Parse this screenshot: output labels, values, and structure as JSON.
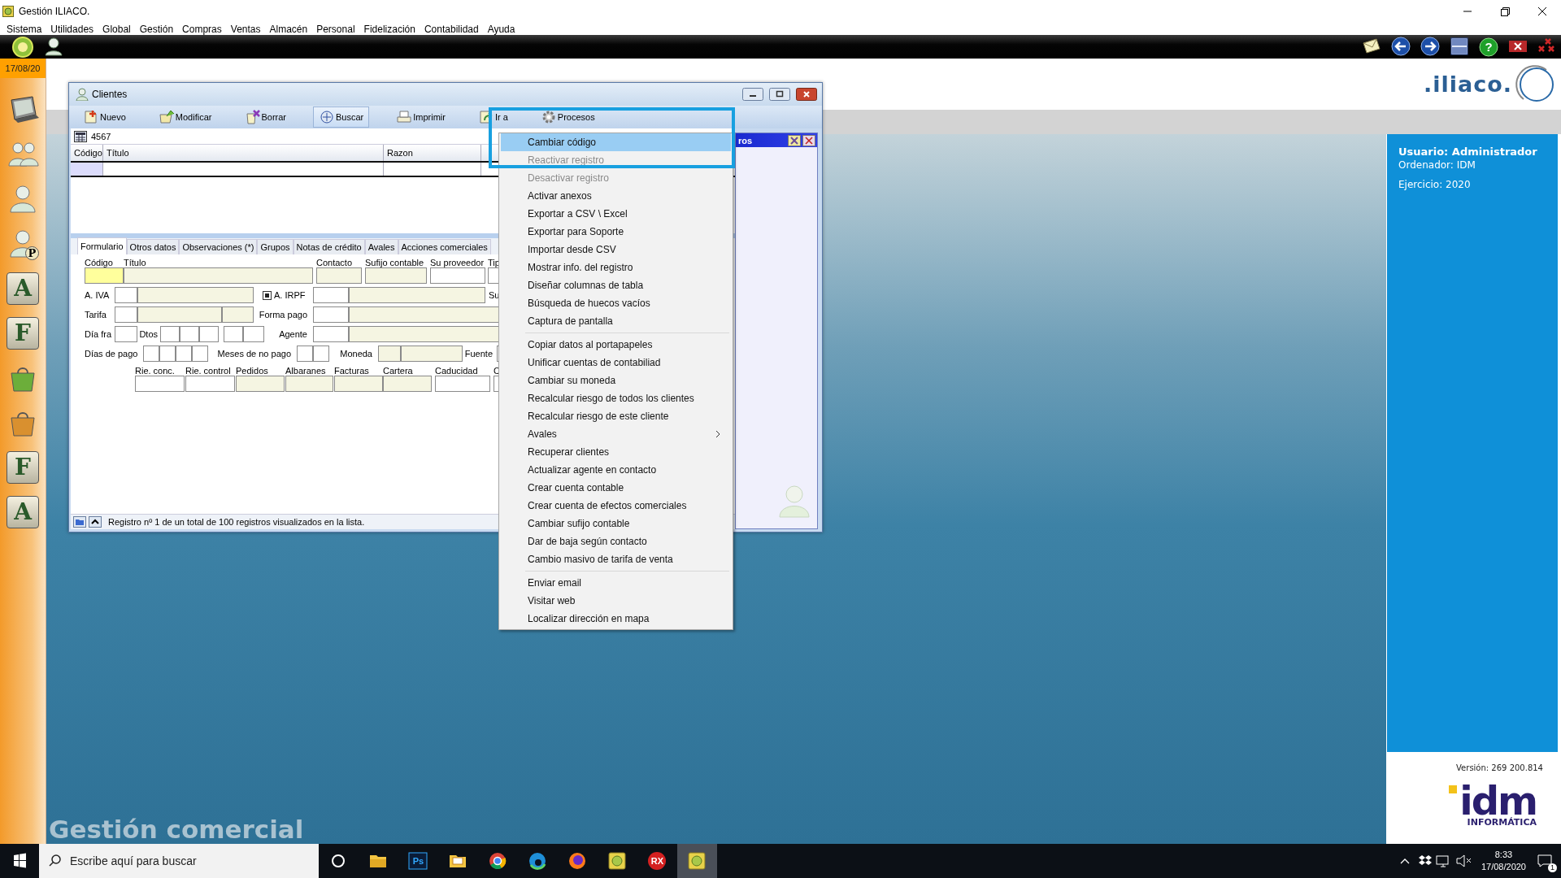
{
  "app": {
    "title": "Gestión ILIACO.",
    "menu": [
      "Sistema",
      "Utilidades",
      "Global",
      "Gestión",
      "Compras",
      "Ventas",
      "Almacén",
      "Personal",
      "Fidelización",
      "Contabilidad",
      "Ayuda"
    ]
  },
  "top_toolbar": {
    "left": [
      {
        "kind": "globe"
      },
      {
        "kind": "user"
      }
    ],
    "right": [
      {
        "kind": "mail"
      },
      {
        "kind": "back"
      },
      {
        "kind": "forward"
      },
      {
        "kind": "window"
      },
      {
        "kind": "help",
        "label": "?"
      },
      {
        "kind": "close"
      },
      {
        "kind": "close-all"
      }
    ]
  },
  "sidebar": {
    "date": "17/08/20",
    "items": [
      {
        "kind": "monitor"
      },
      {
        "kind": "people"
      },
      {
        "kind": "person"
      },
      {
        "kind": "person-letter",
        "label": "P"
      },
      {
        "kind": "letter",
        "label": "A"
      },
      {
        "kind": "letter",
        "label": "F"
      },
      {
        "kind": "bag",
        "color": "#6cae3a"
      },
      {
        "kind": "bag",
        "color": "#d9902f"
      },
      {
        "kind": "letter",
        "label": "F"
      },
      {
        "kind": "letter",
        "label": "A"
      }
    ]
  },
  "clients_window": {
    "title": "Clientes",
    "toolbar": [
      {
        "kind": "new",
        "label": "Nuevo",
        "selected": false
      },
      {
        "kind": "edit",
        "label": "Modificar",
        "selected": false
      },
      {
        "kind": "delete",
        "label": "Borrar",
        "selected": false
      },
      {
        "kind": "search",
        "label": "Buscar",
        "selected": true
      },
      {
        "kind": "print",
        "label": "Imprimir",
        "selected": false
      },
      {
        "kind": "goto",
        "label": "Ir a",
        "selected": false
      },
      {
        "kind": "process",
        "label": "Procesos",
        "selected": false
      }
    ],
    "record_code": "4567",
    "table": {
      "columns": [
        "Código",
        "Título",
        "Razon"
      ],
      "rows": [
        {
          "selected": true
        }
      ]
    },
    "tabs": [
      {
        "label": "Formulario",
        "selected": true
      },
      {
        "label": "Otros datos",
        "selected": false
      },
      {
        "label": "Observaciones (*)",
        "selected": false
      },
      {
        "label": "Grupos",
        "selected": false
      },
      {
        "label": "Notas de crédito",
        "selected": false
      },
      {
        "label": "Avales",
        "selected": false
      },
      {
        "label": "Acciones comerciales",
        "selected": false
      }
    ],
    "form": [
      {
        "kind": "stacked",
        "items": [
          {
            "label": "Código",
            "kind": "focused-field"
          },
          {
            "label": "Título",
            "kind": "readonly-field"
          },
          {
            "label": "Contacto",
            "kind": "readonly-field"
          },
          {
            "label": "Sufijo contable",
            "kind": "readonly-field"
          },
          {
            "label": "Su proveedor",
            "kind": "field"
          },
          {
            "label": "Tip",
            "kind": "field"
          }
        ]
      },
      {
        "kind": "inline",
        "items": [
          {
            "kind": "label",
            "text": "A. IVA"
          },
          {
            "kind": "field"
          },
          {
            "kind": "readonly-field"
          },
          {
            "kind": "checkbox",
            "text": "A. IRPF",
            "checked": true
          },
          {
            "kind": "field"
          },
          {
            "kind": "readonly-field"
          },
          {
            "kind": "label",
            "text": "Su"
          }
        ]
      },
      {
        "kind": "inline",
        "items": [
          {
            "kind": "label",
            "text": "Tarifa"
          },
          {
            "kind": "field"
          },
          {
            "kind": "readonly-field"
          },
          {
            "kind": "readonly-field"
          },
          {
            "kind": "label",
            "text": "Forma pago"
          },
          {
            "kind": "field"
          },
          {
            "kind": "readonly-field"
          }
        ]
      },
      {
        "kind": "inline",
        "items": [
          {
            "kind": "label",
            "text": "Día fra"
          },
          {
            "kind": "field"
          },
          {
            "kind": "label",
            "text": "Dtos"
          },
          {
            "kind": "field"
          },
          {
            "kind": "field"
          },
          {
            "kind": "field"
          },
          {
            "kind": "field"
          },
          {
            "kind": "field"
          },
          {
            "kind": "label",
            "text": "Agente"
          },
          {
            "kind": "field"
          },
          {
            "kind": "readonly-field"
          }
        ]
      },
      {
        "kind": "inline",
        "items": [
          {
            "kind": "label",
            "text": "Días de pago"
          },
          {
            "kind": "field"
          },
          {
            "kind": "field"
          },
          {
            "kind": "field"
          },
          {
            "kind": "field"
          },
          {
            "kind": "label",
            "text": "Meses de no pago"
          },
          {
            "kind": "field"
          },
          {
            "kind": "field"
          },
          {
            "kind": "label",
            "text": "Moneda"
          },
          {
            "kind": "readonly-field"
          },
          {
            "kind": "readonly-field"
          },
          {
            "kind": "label",
            "text": "Fuente"
          },
          {
            "kind": "field"
          }
        ]
      },
      {
        "kind": "stacked",
        "items": [
          {
            "label": "Rie. conc.",
            "kind": "field"
          },
          {
            "label": "Rie. control",
            "kind": "field"
          },
          {
            "label": "Pedidos",
            "kind": "readonly-field"
          },
          {
            "label": "Albaranes",
            "kind": "readonly-field"
          },
          {
            "label": "Facturas",
            "kind": "readonly-field"
          },
          {
            "label": "Cartera",
            "kind": "readonly-field"
          },
          {
            "label": "Caducidad",
            "kind": "field"
          },
          {
            "label": "C",
            "kind": "field"
          }
        ]
      }
    ],
    "status": "Registro nº 1 de un total de 100 registros visualizados en la lista.",
    "side_panel": {
      "title": "ros"
    }
  },
  "context_menu": [
    {
      "kind": "item",
      "label": "Cambiar código",
      "selected": true,
      "disabled": false,
      "submenu": false
    },
    {
      "kind": "item",
      "label": "Reactivar registro",
      "selected": false,
      "disabled": true,
      "submenu": false
    },
    {
      "kind": "item",
      "label": "Desactivar registro",
      "selected": false,
      "disabled": true,
      "submenu": false
    },
    {
      "kind": "item",
      "label": "Activar anexos",
      "selected": false,
      "disabled": false,
      "submenu": false
    },
    {
      "kind": "item",
      "label": "Exportar a CSV \\ Excel",
      "selected": false,
      "disabled": false,
      "submenu": false
    },
    {
      "kind": "item",
      "label": "Exportar para Soporte",
      "selected": false,
      "disabled": false,
      "submenu": false
    },
    {
      "kind": "item",
      "label": "Importar desde CSV",
      "selected": false,
      "disabled": false,
      "submenu": false
    },
    {
      "kind": "item",
      "label": "Mostrar info. del registro",
      "selected": false,
      "disabled": false,
      "submenu": false
    },
    {
      "kind": "item",
      "label": "Diseñar columnas de tabla",
      "selected": false,
      "disabled": false,
      "submenu": false
    },
    {
      "kind": "item",
      "label": "Búsqueda de huecos vacíos",
      "selected": false,
      "disabled": false,
      "submenu": false
    },
    {
      "kind": "item",
      "label": "Captura de pantalla",
      "selected": false,
      "disabled": false,
      "submenu": false
    },
    {
      "kind": "separator"
    },
    {
      "kind": "item",
      "label": "Copiar datos al portapapeles",
      "selected": false,
      "disabled": false,
      "submenu": false
    },
    {
      "kind": "item",
      "label": "Unificar cuentas de contabiliad",
      "selected": false,
      "disabled": false,
      "submenu": false
    },
    {
      "kind": "item",
      "label": "Cambiar su moneda",
      "selected": false,
      "disabled": false,
      "submenu": false
    },
    {
      "kind": "item",
      "label": "Recalcular riesgo de todos los clientes",
      "selected": false,
      "disabled": false,
      "submenu": false
    },
    {
      "kind": "item",
      "label": "Recalcular riesgo de este cliente",
      "selected": false,
      "disabled": false,
      "submenu": false
    },
    {
      "kind": "item",
      "label": "Avales",
      "selected": false,
      "disabled": false,
      "submenu": true
    },
    {
      "kind": "item",
      "label": "Recuperar clientes",
      "selected": false,
      "disabled": false,
      "submenu": false
    },
    {
      "kind": "item",
      "label": "Actualizar agente en contacto",
      "selected": false,
      "disabled": false,
      "submenu": false
    },
    {
      "kind": "item",
      "label": "Crear cuenta contable",
      "selected": false,
      "disabled": false,
      "submenu": false
    },
    {
      "kind": "item",
      "label": "Crear cuenta de efectos comerciales",
      "selected": false,
      "disabled": false,
      "submenu": false
    },
    {
      "kind": "item",
      "label": "Cambiar sufijo contable",
      "selected": false,
      "disabled": false,
      "submenu": false
    },
    {
      "kind": "item",
      "label": "Dar de baja según contacto",
      "selected": false,
      "disabled": false,
      "submenu": false
    },
    {
      "kind": "item",
      "label": "Cambio masivo de tarifa de venta",
      "selected": false,
      "disabled": false,
      "submenu": false
    },
    {
      "kind": "separator"
    },
    {
      "kind": "item",
      "label": "Enviar email",
      "selected": false,
      "disabled": false,
      "submenu": false
    },
    {
      "kind": "item",
      "label": "Visitar web",
      "selected": false,
      "disabled": false,
      "submenu": false
    },
    {
      "kind": "item",
      "label": "Localizar dirección en mapa",
      "selected": false,
      "disabled": false,
      "submenu": false
    }
  ],
  "caption": "Gestión comercial",
  "right_panel": {
    "logo_text": ".iliaco.",
    "user": "Usuario: Administrador",
    "computer": "Ordenador:  IDM",
    "year": "Ejercicio: 2020",
    "version": "Versión: 269 200.814",
    "brand": "idm",
    "brand_sub": "INFORMÁTICA"
  },
  "taskbar": {
    "search_placeholder": "Escribe aquí para buscar",
    "apps": [
      {
        "kind": "task-view",
        "selected": false
      },
      {
        "kind": "folder",
        "selected": false
      },
      {
        "kind": "ps",
        "label": "Ps",
        "selected": false
      },
      {
        "kind": "mail-folder",
        "selected": false
      },
      {
        "kind": "chrome",
        "selected": false
      },
      {
        "kind": "edge",
        "selected": false
      },
      {
        "kind": "firefox",
        "selected": false
      },
      {
        "kind": "app",
        "selected": false
      },
      {
        "kind": "rx",
        "label": "RX",
        "selected": false
      },
      {
        "kind": "app",
        "selected": true
      }
    ],
    "time": "8:33",
    "date": "17/08/2020",
    "notifications": "1"
  }
}
